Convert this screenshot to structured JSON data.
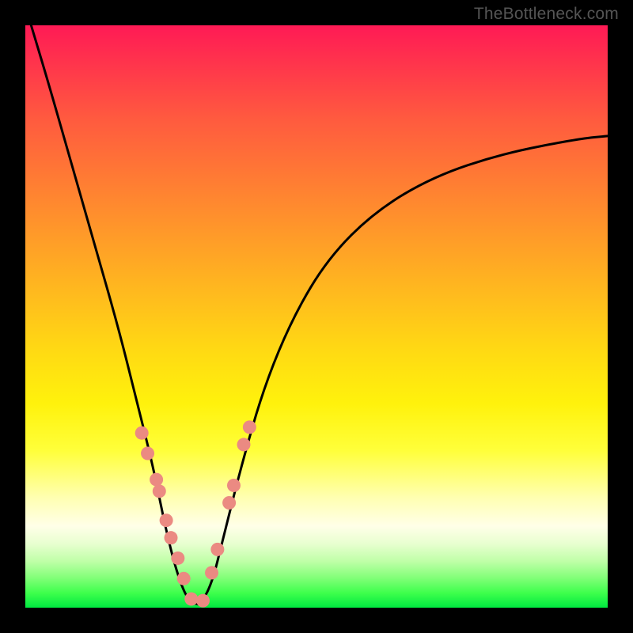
{
  "watermark": {
    "text": "TheBottleneck.com"
  },
  "chart_data": {
    "type": "line",
    "title": "",
    "xlabel": "",
    "ylabel": "",
    "xlim": [
      0,
      100
    ],
    "ylim": [
      0,
      100
    ],
    "grid": false,
    "legend": false,
    "background_gradient": {
      "top_color": "#ff1a55",
      "bottom_color": "#00e840",
      "note": "vertical red→orange→yellow→pale→green rainbow"
    },
    "series": [
      {
        "name": "left-branch",
        "description": "steep falling curve from top-left into a minimum near x≈28",
        "stroke": "#000000",
        "x": [
          1,
          4,
          8,
          12,
          16,
          19,
          22,
          24,
          26,
          28,
          30
        ],
        "y": [
          100,
          90,
          76,
          62,
          48,
          36,
          24,
          14,
          6,
          1,
          0.5
        ]
      },
      {
        "name": "right-branch",
        "description": "curve rising from the minimum and flattening toward top-right",
        "stroke": "#000000",
        "x": [
          30,
          32,
          34,
          37,
          41,
          46,
          52,
          60,
          70,
          82,
          95,
          100
        ],
        "y": [
          0.5,
          4,
          12,
          24,
          38,
          50,
          60,
          68,
          74,
          78,
          80.5,
          81
        ]
      },
      {
        "name": "scatter-points",
        "type": "scatter",
        "description": "salmon dots clustered along the lower V-shape of the curve",
        "marker_color": "#eb8a82",
        "x": [
          20,
          21,
          22.5,
          23,
          24.2,
          25,
          26.2,
          27.2,
          28.5,
          30.5,
          32,
          33,
          35,
          35.8,
          37.5,
          38.5
        ],
        "y": [
          30,
          26.5,
          22,
          20,
          15,
          12,
          8.5,
          5,
          1.5,
          1.2,
          6,
          10,
          18,
          21,
          28,
          31
        ]
      }
    ]
  }
}
